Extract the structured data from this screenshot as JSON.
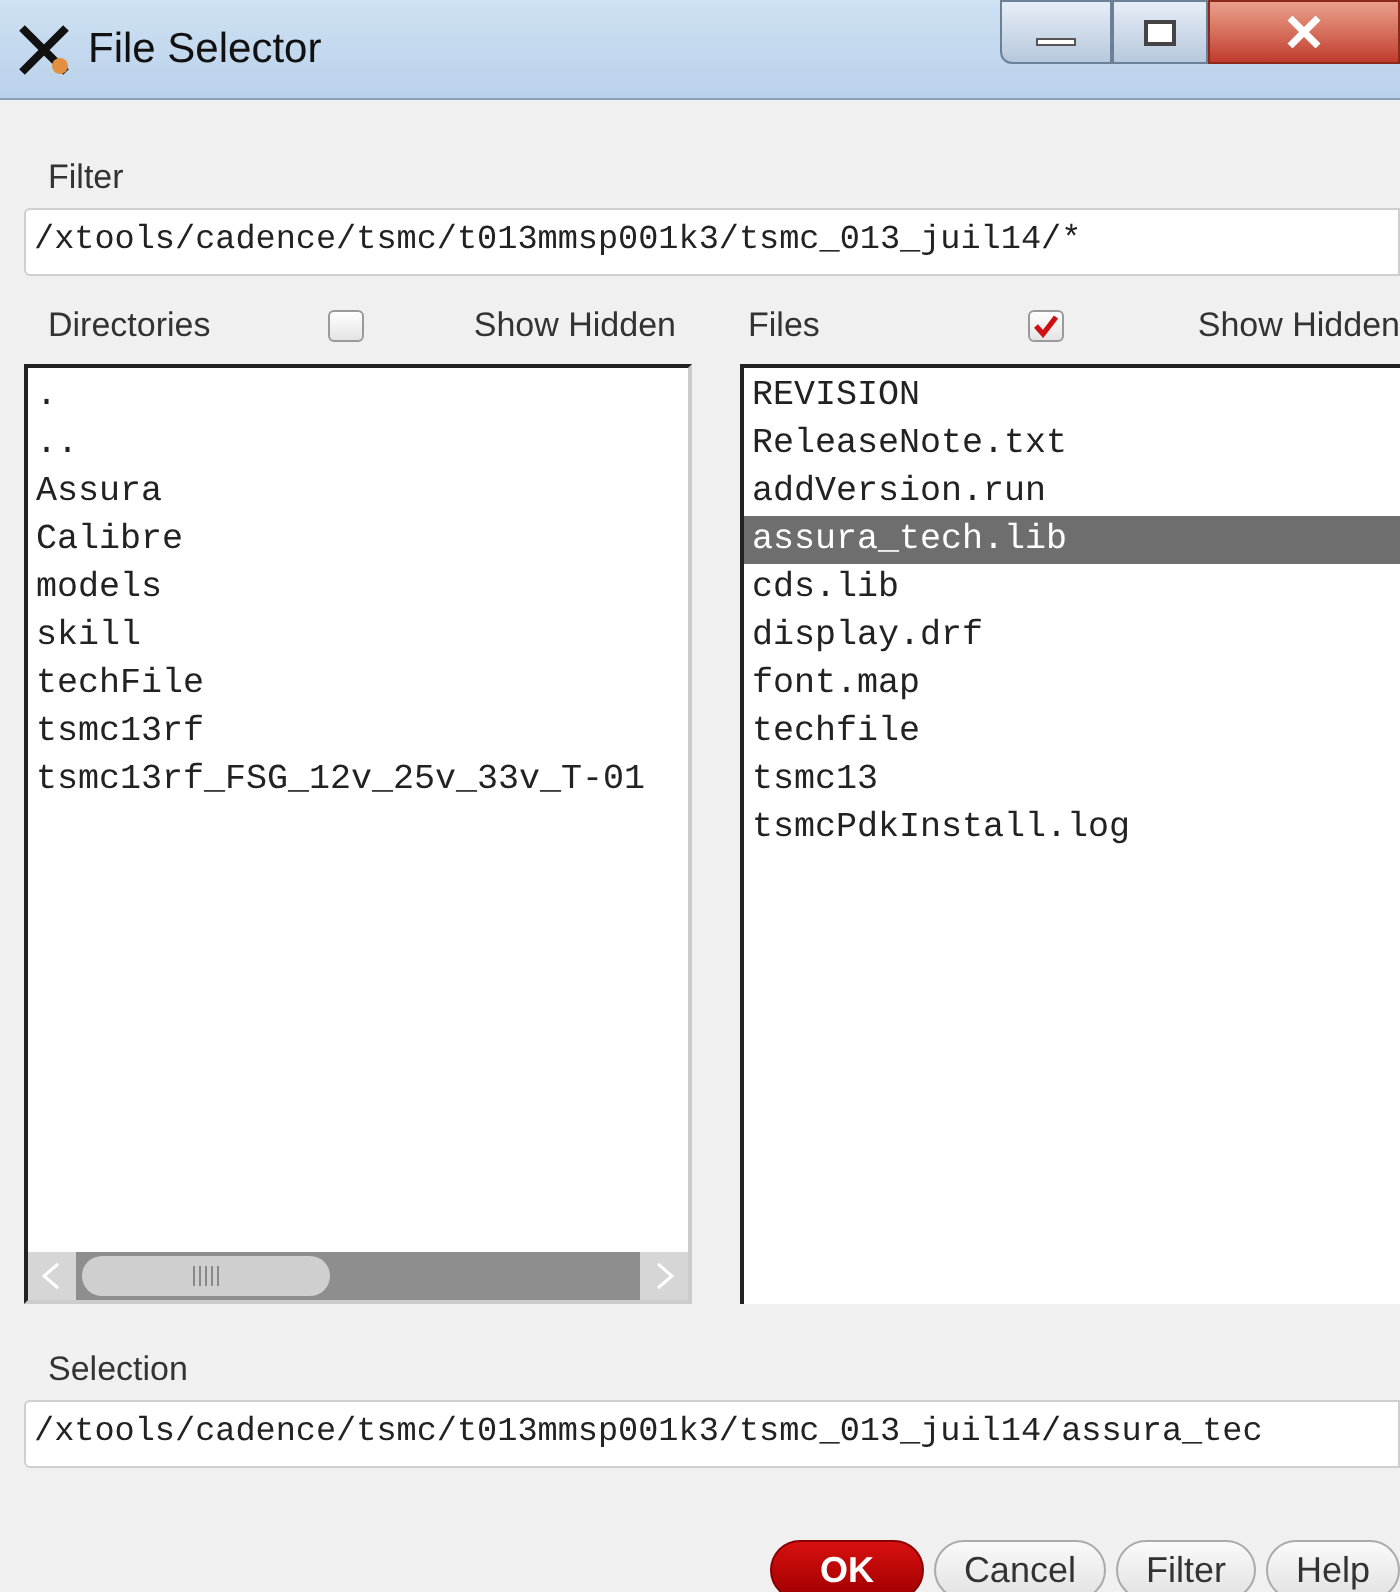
{
  "window": {
    "title": "File Selector"
  },
  "filter": {
    "label": "Filter",
    "value": "/xtools/cadence/tsmc/t013mmsp001k3/tsmc_013_juil14/*"
  },
  "directories": {
    "label": "Directories",
    "show_hidden": {
      "label": "Show Hidden",
      "checked": false
    },
    "items": [
      {
        "name": ".",
        "selected": false
      },
      {
        "name": "..",
        "selected": false
      },
      {
        "name": "Assura",
        "selected": false
      },
      {
        "name": "Calibre",
        "selected": false
      },
      {
        "name": "models",
        "selected": false
      },
      {
        "name": "skill",
        "selected": false
      },
      {
        "name": "techFile",
        "selected": false
      },
      {
        "name": "tsmc13rf",
        "selected": false
      },
      {
        "name": "tsmc13rf_FSG_12v_25v_33v_T-01",
        "selected": false
      }
    ]
  },
  "files": {
    "label": "Files",
    "show_hidden": {
      "label": "Show Hidden",
      "checked": true
    },
    "items": [
      {
        "name": "REVISION",
        "selected": false
      },
      {
        "name": "ReleaseNote.txt",
        "selected": false
      },
      {
        "name": "addVersion.run",
        "selected": false
      },
      {
        "name": "assura_tech.lib",
        "selected": true
      },
      {
        "name": "cds.lib",
        "selected": false
      },
      {
        "name": "display.drf",
        "selected": false
      },
      {
        "name": "font.map",
        "selected": false
      },
      {
        "name": "techfile",
        "selected": false
      },
      {
        "name": "tsmc13",
        "selected": false
      },
      {
        "name": "tsmcPdkInstall.log",
        "selected": false
      }
    ]
  },
  "selection": {
    "label": "Selection",
    "value": "/xtools/cadence/tsmc/t013mmsp001k3/tsmc_013_juil14/assura_tec"
  },
  "buttons": [
    {
      "label": "OK",
      "kind": "primary"
    },
    {
      "label": "Cancel",
      "kind": "normal"
    },
    {
      "label": "Filter",
      "kind": "normal"
    },
    {
      "label": "Help",
      "kind": "normal"
    }
  ]
}
